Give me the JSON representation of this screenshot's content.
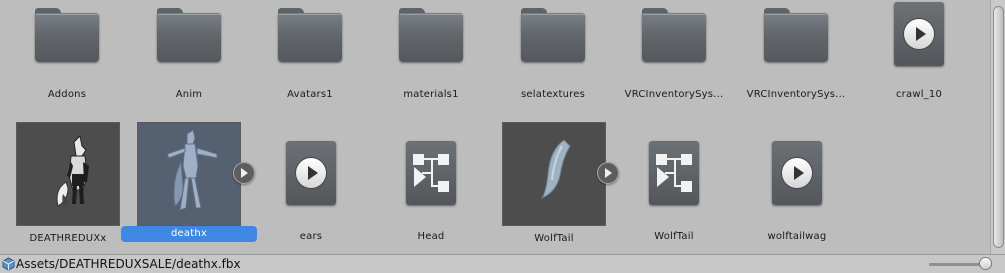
{
  "items": [
    {
      "label": "Addons",
      "kind": "folder",
      "icon": "folder-icon"
    },
    {
      "label": "Anim",
      "kind": "folder",
      "icon": "folder-icon"
    },
    {
      "label": "Avatars1",
      "kind": "folder",
      "icon": "folder-icon"
    },
    {
      "label": "materials1",
      "kind": "folder",
      "icon": "folder-icon"
    },
    {
      "label": "selatextures",
      "kind": "folder",
      "icon": "folder-icon"
    },
    {
      "label": "VRCInventorySys...",
      "kind": "folder",
      "icon": "folder-icon"
    },
    {
      "label": "VRCInventorySys...",
      "kind": "folder",
      "icon": "folder-icon"
    },
    {
      "label": "crawl_10",
      "kind": "media",
      "icon": "audio-clip-icon"
    },
    {
      "label": "DEATHREDUXx",
      "kind": "model",
      "icon": "model-preview-icon"
    },
    {
      "label": "deathx",
      "kind": "model",
      "icon": "model-preview-icon",
      "selected": true
    },
    {
      "label": "ears",
      "kind": "media",
      "icon": "audio-clip-icon"
    },
    {
      "label": "Head",
      "kind": "prefab",
      "icon": "blend-tree-icon"
    },
    {
      "label": "WolfTail",
      "kind": "model",
      "icon": "model-preview-icon"
    },
    {
      "label": "WolfTail",
      "kind": "prefab",
      "icon": "blend-tree-icon"
    },
    {
      "label": "wolftailwag",
      "kind": "media",
      "icon": "audio-clip-icon"
    }
  ],
  "status": {
    "path": "Assets/DEATHREDUXSALE/deathx.fbx",
    "icon": "asset-cube-icon"
  },
  "zoom_slider": {
    "value": 0.95
  },
  "colors": {
    "background": "#bdbdbd",
    "selection": "#3f87e2",
    "folder": "#6a6f74"
  }
}
